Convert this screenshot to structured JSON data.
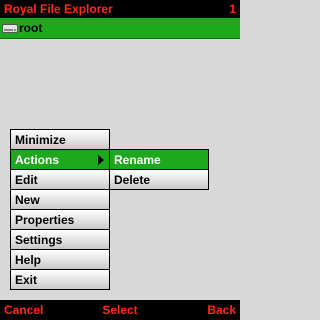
{
  "app": {
    "title": "Royal File Explorer",
    "count": "1"
  },
  "list": {
    "items": [
      {
        "label": "root",
        "icon": "drive-icon"
      }
    ]
  },
  "menu": {
    "items": [
      {
        "label": "Minimize"
      },
      {
        "label": "Actions",
        "has_submenu": true,
        "selected": true
      },
      {
        "label": "Edit"
      },
      {
        "label": "New"
      },
      {
        "label": "Properties"
      },
      {
        "label": "Settings"
      },
      {
        "label": "Help"
      },
      {
        "label": "Exit"
      }
    ]
  },
  "submenu": {
    "parent": "Actions",
    "items": [
      {
        "label": "Rename",
        "selected": true
      },
      {
        "label": "Delete"
      }
    ]
  },
  "softkeys": {
    "left": "Cancel",
    "center": "Select",
    "right": "Back"
  },
  "colors": {
    "accent_green": "#1ea81e",
    "softkey_red": "#ff2a1a",
    "background": "#d8d8d8"
  }
}
